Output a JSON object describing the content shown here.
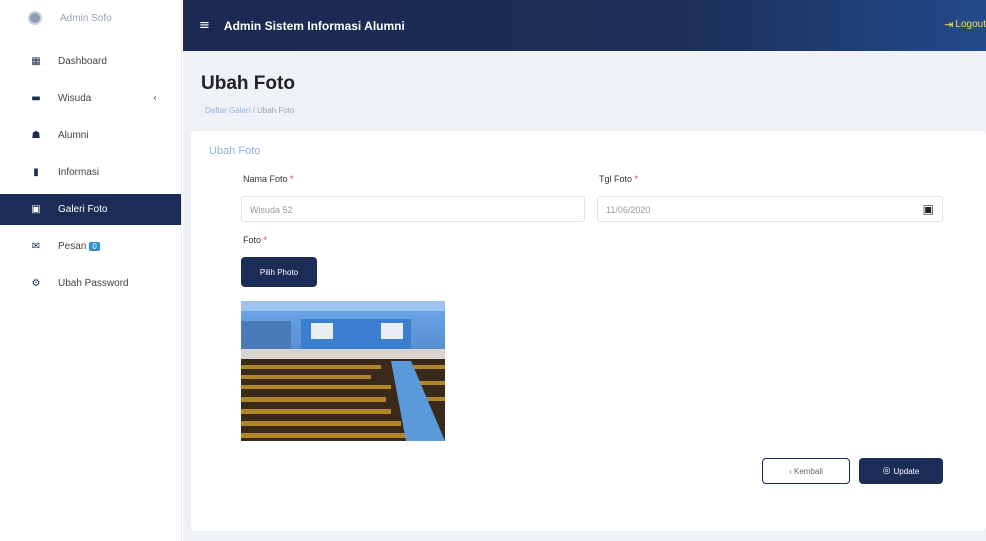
{
  "sidebar": {
    "brand": "Admin Sofo",
    "items": [
      {
        "label": "Dashboard",
        "icon": "grid-icon"
      },
      {
        "label": "Wisuda",
        "icon": "graduation-cap-icon",
        "chevron": "‹"
      },
      {
        "label": "Alumni",
        "icon": "users-icon"
      },
      {
        "label": "Informasi",
        "icon": "file-icon"
      },
      {
        "label": "Galeri Foto",
        "icon": "image-icon"
      },
      {
        "label": "Pesan",
        "icon": "mail-icon",
        "badge": "0"
      },
      {
        "label": "Ubah Password",
        "icon": "gear-icon"
      }
    ],
    "active_color": "#1b2d56"
  },
  "topbar": {
    "title": "Admin Sistem Informasi Alumni",
    "logout": "Logout",
    "logout_color": "#f2e24a"
  },
  "page": {
    "title": "Ubah Foto",
    "breadcrumb_link": "Daftar Galeri",
    "breadcrumb_sep": " / ",
    "breadcrumb_current": "Ubah Foto"
  },
  "form": {
    "card_title": "Ubah Foto",
    "nama_label": "Nama Foto",
    "nama_value": "Wisuda 52",
    "tgl_label": "Tgl Foto",
    "tgl_value": "11/06/2020",
    "foto_label": "Foto",
    "pick_label": "Pilih Photo",
    "back_label": "‹ Kembali",
    "update_label": "Update"
  }
}
